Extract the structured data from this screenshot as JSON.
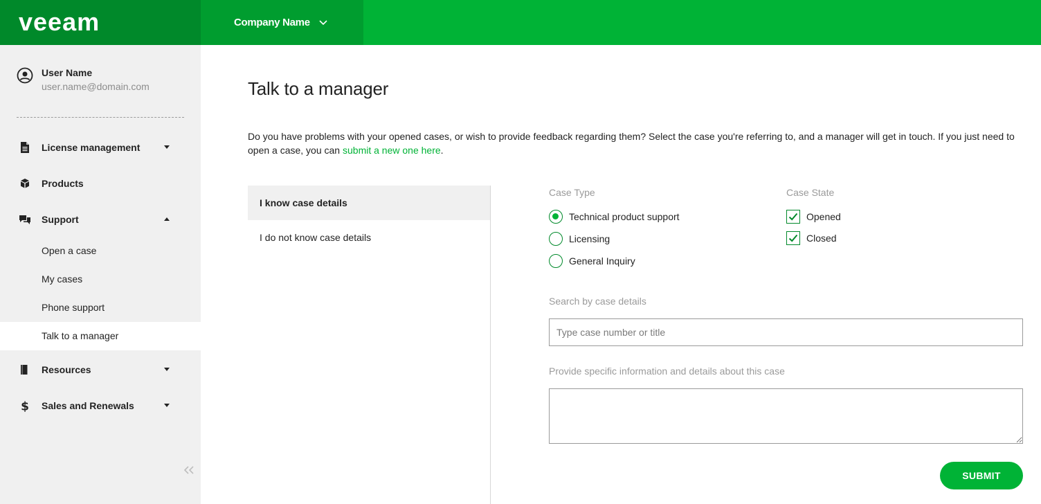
{
  "header": {
    "logo_text": "veeam",
    "company_name": "Company Name"
  },
  "user": {
    "name": "User Name",
    "email": "user.name@domain.com"
  },
  "sidebar": {
    "items": [
      {
        "label": "License management",
        "icon": "document-icon",
        "caret": "down"
      },
      {
        "label": "Products",
        "icon": "cube-icon"
      },
      {
        "label": "Support",
        "icon": "chat-icon",
        "caret": "up"
      },
      {
        "label": "Resources",
        "icon": "book-icon",
        "caret": "down"
      },
      {
        "label": "Sales and Renewals",
        "icon": "dollar-icon",
        "caret": "down"
      }
    ],
    "support_sub": [
      {
        "label": "Open a case"
      },
      {
        "label": "My cases"
      },
      {
        "label": "Phone support"
      },
      {
        "label": "Talk to a manager",
        "active": true
      }
    ]
  },
  "main": {
    "title": "Talk to a manager",
    "intro_text": "Do you have problems with your opened cases, or wish to provide feedback regarding them? Select the case you're referring to, and a manager will get in touch. If you just need to open a case, you can ",
    "intro_link": "submit a new one here",
    "intro_end": ".",
    "tabs": [
      {
        "label": "I know case details",
        "active": true
      },
      {
        "label": "I do not know case details"
      }
    ],
    "case_type": {
      "label": "Case Type",
      "options": [
        "Technical product support",
        "Licensing",
        "General Inquiry"
      ],
      "selected": "Technical product support"
    },
    "case_state": {
      "label": "Case State",
      "options": [
        {
          "label": "Opened",
          "checked": true
        },
        {
          "label": "Closed",
          "checked": true
        }
      ]
    },
    "search": {
      "label": "Search by case details",
      "placeholder": "Type case number or title",
      "value": ""
    },
    "details": {
      "label": "Provide specific information and details about this case",
      "value": ""
    },
    "submit_label": "SUBMIT"
  },
  "colors": {
    "brand_green": "#00b336",
    "dark_green": "#00892a",
    "sidebar_bg": "#f0f0f0"
  }
}
